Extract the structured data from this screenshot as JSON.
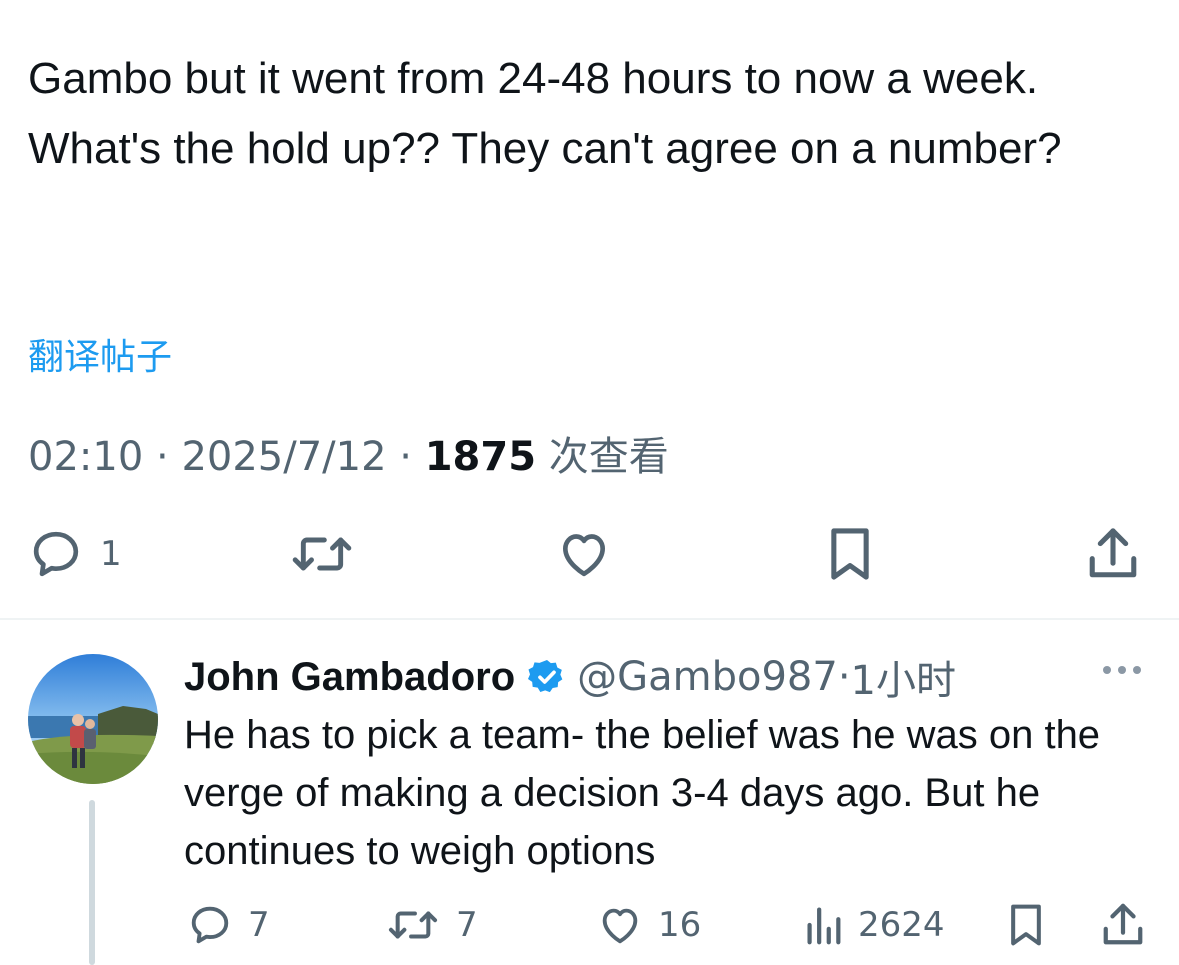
{
  "tweet": {
    "text": "Gambo but it went from 24-48 hours to now a week. What's the hold up?? They can't agree on a number?",
    "translate_label": "翻译帖子",
    "time": "02:10",
    "date": "2025/7/12",
    "views_count": "1875",
    "views_label": "次查看",
    "replies_count": "1"
  },
  "reply": {
    "name": "John Gambadoro",
    "handle": "@Gambo987",
    "time": "1小时",
    "text": "He has to pick a team- the belief was he was on the verge of making a decision 3-4 days ago. But he continues to weigh options",
    "replies_count": "7",
    "retweets_count": "7",
    "likes_count": "16",
    "views_count": "2624"
  },
  "colors": {
    "accent": "#1d9bf0",
    "text_primary": "#0f1419",
    "text_secondary": "#536471",
    "divider": "#eff3f4"
  },
  "icons": {
    "reply": "speech-bubble-icon",
    "retweet": "retweet-arrows-icon",
    "like": "heart-icon",
    "bookmark": "bookmark-icon",
    "share": "share-upload-icon",
    "views": "bar-chart-icon",
    "verified": "verified-badge-icon",
    "more": "more-dots-icon"
  }
}
